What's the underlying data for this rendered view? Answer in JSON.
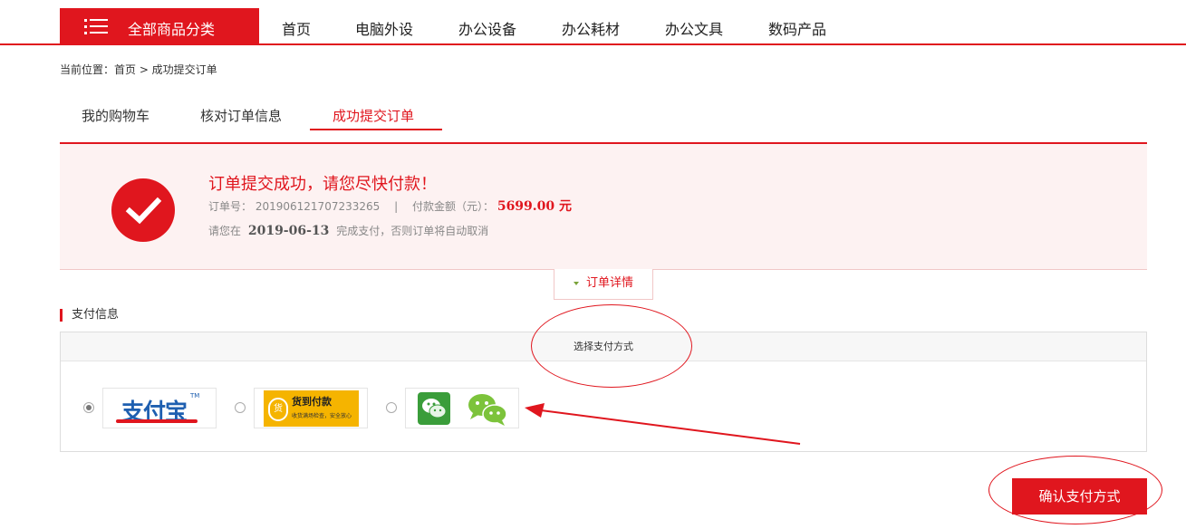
{
  "nav": {
    "all_categories": "全部商品分类",
    "items": [
      "首页",
      "电脑外设",
      "办公设备",
      "办公耗材",
      "办公文具",
      "数码产品"
    ]
  },
  "breadcrumb": "当前位置：首页 > 成功提交订单",
  "tabs": [
    "我的购物车",
    "核对订单信息",
    "成功提交订单"
  ],
  "active_tab": "成功提交订单",
  "success": {
    "title": "订单提交成功，请您尽快付款！",
    "order_no_label": "订单号：",
    "order_no": "2019061217072332 65",
    "separator": "|",
    "amount_label": "付款金额（元）：",
    "amount": "5699.00 元",
    "deadline_prefix": "请您在",
    "deadline_date": "2019-06-13",
    "deadline_suffix": "完成支付，否则订单将自动取消"
  },
  "order_detail_toggle": "订单详情",
  "payment": {
    "heading": "支付信息",
    "select_label": "选择支付方式",
    "options": [
      {
        "name": "alipay",
        "logo_text": "支付宝",
        "tm": "TM",
        "checked": true
      },
      {
        "name": "cash-on-delivery",
        "logo_text": "货到付款",
        "sub_text": "收货满场检查，安全放心",
        "coin": "货",
        "checked": false
      },
      {
        "name": "wechat",
        "checked": false
      }
    ],
    "confirm_button": "确认支付方式"
  },
  "colors": {
    "brand_red": "#e0161e",
    "success_bg": "#fdf2f2",
    "alipay_blue": "#1e5fb0",
    "cod_yellow": "#f5b400",
    "wechat_green": "#3a9d3a"
  }
}
